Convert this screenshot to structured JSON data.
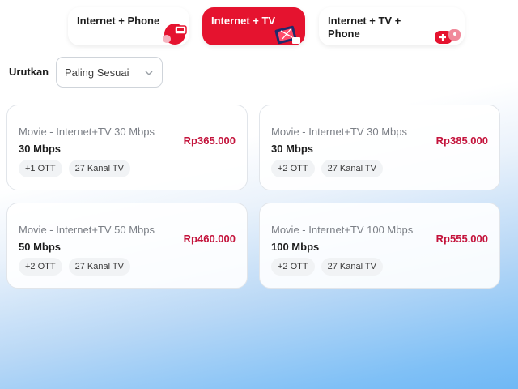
{
  "tabs": [
    {
      "label": "Internet + Phone",
      "active": false,
      "icon": "phone-icon"
    },
    {
      "label": "Internet + TV",
      "active": true,
      "icon": "tv-icon"
    },
    {
      "label": "Internet + TV + Phone",
      "active": false,
      "icon": "gamepad-icon"
    }
  ],
  "sort": {
    "label": "Urutkan",
    "value": "Paling Sesuai"
  },
  "cards": [
    {
      "name": "Movie - Internet+TV 30 Mbps",
      "speed": "30 Mbps",
      "price": "Rp365.000",
      "ott": "+1 OTT",
      "channels": "27 Kanal TV"
    },
    {
      "name": "Movie - Internet+TV 30 Mbps",
      "speed": "30 Mbps",
      "price": "Rp385.000",
      "ott": "+2 OTT",
      "channels": "27 Kanal TV"
    },
    {
      "name": "Movie - Internet+TV 50 Mbps",
      "speed": "50 Mbps",
      "price": "Rp460.000",
      "ott": "+2 OTT",
      "channels": "27 Kanal TV"
    },
    {
      "name": "Movie - Internet+TV 100 Mbps",
      "speed": "100 Mbps",
      "price": "Rp555.000",
      "ott": "+2 OTT",
      "channels": "27 Kanal TV"
    }
  ],
  "colors": {
    "accent": "#e5132f",
    "price": "#c4143c"
  }
}
